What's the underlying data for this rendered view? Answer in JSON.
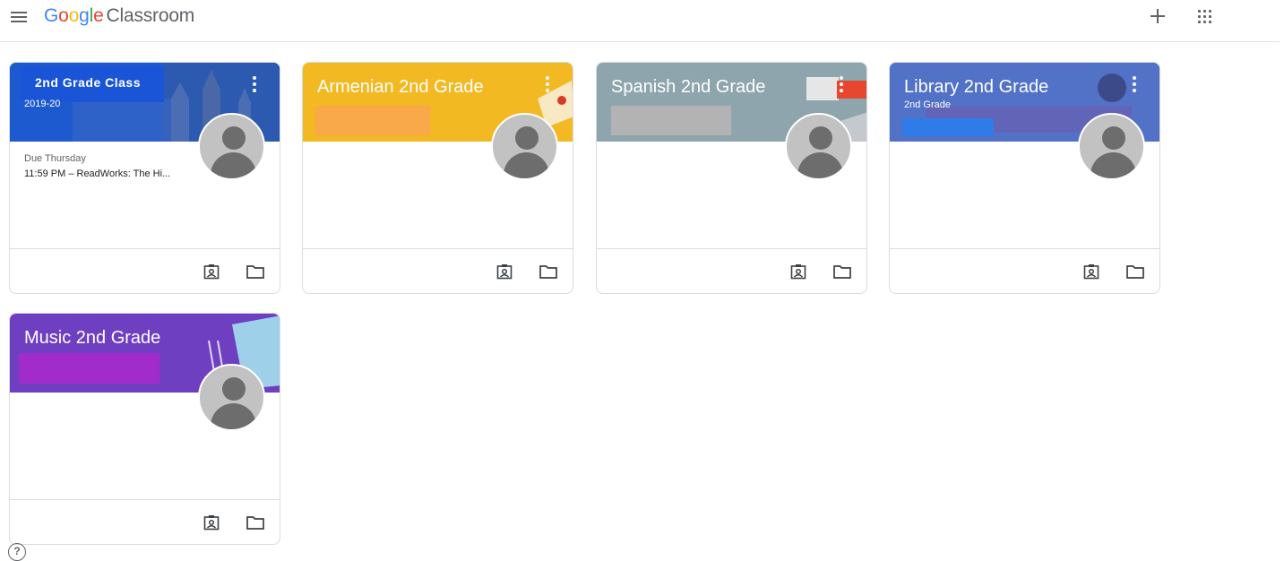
{
  "app": {
    "logo_google": "Google",
    "logo_product": "Classroom",
    "brand_letters": [
      {
        "ch": "G",
        "color": "#4285f4"
      },
      {
        "ch": "o",
        "color": "#ea4335"
      },
      {
        "ch": "o",
        "color": "#fbbc05"
      },
      {
        "ch": "g",
        "color": "#4285f4"
      },
      {
        "ch": "l",
        "color": "#34a853"
      },
      {
        "ch": "e",
        "color": "#ea4335"
      }
    ]
  },
  "header": {
    "menu_icon": "hamburger-menu-icon",
    "create_icon": "plus-icon",
    "apps_icon": "apps-grid-icon"
  },
  "classes": [
    {
      "title": "2nd Grade Class",
      "section": "2019-20",
      "banner_color": "#1a5fd6",
      "due_label": "Due Thursday",
      "due_item": "11:59 PM – ReadWorks: The Hi..."
    },
    {
      "title": "Armenian 2nd Grade",
      "section": "",
      "banner_color": "#f2b922"
    },
    {
      "title": "Spanish 2nd Grade",
      "section": "",
      "banner_color": "#8fa5ad"
    },
    {
      "title": "Library 2nd Grade",
      "section": "2nd Grade",
      "banner_color": "#4f6bc4"
    },
    {
      "title": "Music 2nd Grade",
      "section": "",
      "banner_color": "#6f3fc1"
    }
  ],
  "card_icons": {
    "portfolio": "student-portfolio-icon",
    "folder": "folder-icon"
  },
  "help": {
    "icon": "help-icon",
    "label": "?"
  }
}
